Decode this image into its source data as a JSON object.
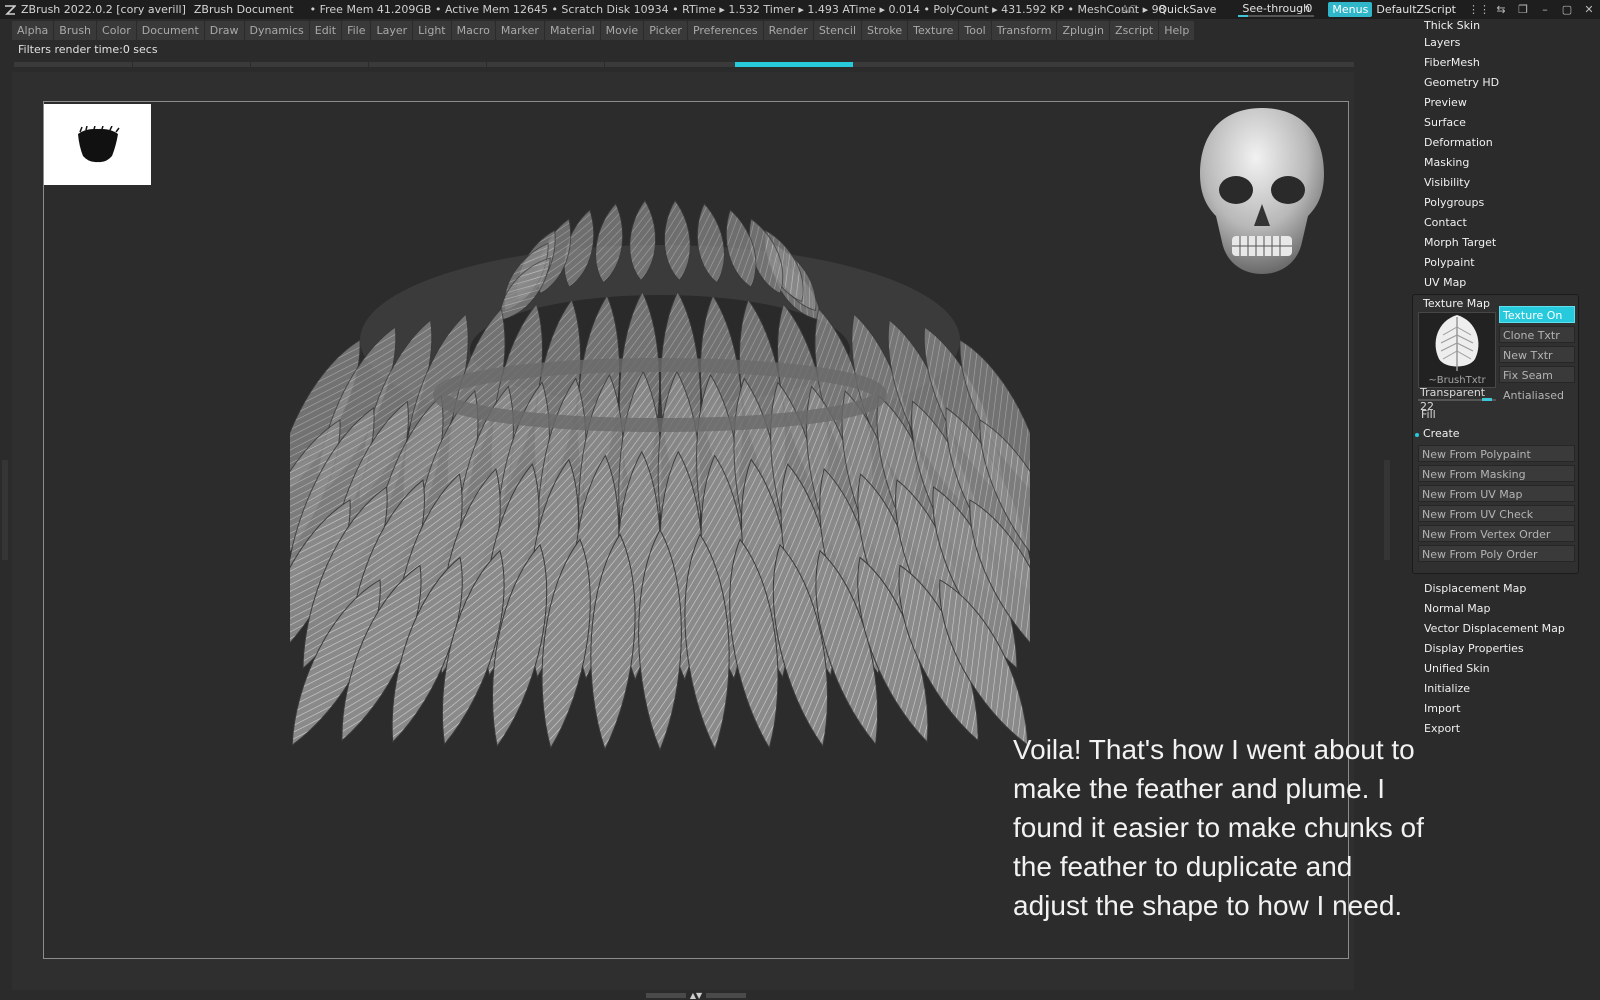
{
  "titlebar": {
    "app_title": "ZBrush 2022.0.2 [cory averill]",
    "document": "ZBrush Document",
    "stats": "• Free Mem 41.209GB • Active Mem 12645 • Scratch Disk 10934 • RTime ▸ 1.532 Timer ▸ 1.493 ATime ▸ 0.014 • PolyCount ▸ 431.592 KP • MeshCount ▸ 98",
    "ac": "AC",
    "quicksave": "QuickSave",
    "seethrough_label": "See-through",
    "seethrough_value": "0",
    "menus": "Menus",
    "default_zscript": "DefaultZScript",
    "accent": "#2fb6c8"
  },
  "menubar": [
    "Alpha",
    "Brush",
    "Color",
    "Document",
    "Draw",
    "Dynamics",
    "Edit",
    "File",
    "Layer",
    "Light",
    "Macro",
    "Marker",
    "Material",
    "Movie",
    "Picker",
    "Preferences",
    "Render",
    "Stencil",
    "Stroke",
    "Texture",
    "Tool",
    "Transform",
    "Zplugin",
    "Zscript",
    "Help"
  ],
  "status": {
    "filters": "Filters render time:0 secs"
  },
  "caption": "Voila! That's how I went about to make the feather and plume. I found it easier to make chunks of the feather to duplicate and adjust the shape to how I need.",
  "tool_palette": {
    "items_top": [
      "Thick Skin",
      "Layers",
      "FiberMesh",
      "Geometry HD",
      "Preview",
      "Surface",
      "Deformation",
      "Masking",
      "Visibility",
      "Polygroups",
      "Contact",
      "Morph Target",
      "Polypaint",
      "UV Map"
    ],
    "texture_map": {
      "title": "Texture Map",
      "thumb_label": "~BrushTxtr",
      "texture_on": "Texture On",
      "clone_txtr": "Clone Txtr",
      "new_txtr": "New Txtr",
      "fix_seam": "Fix Seam",
      "transparent_label": "Transparent",
      "transparent_value": "22",
      "antialiased": "Antialiased",
      "fill": "Fill",
      "create": "Create",
      "create_buttons": [
        "New From Polypaint",
        "New From Masking",
        "New From UV Map",
        "New From UV Check",
        "New From Vertex Order",
        "New From Poly Order"
      ]
    },
    "items_bottom": [
      "Displacement Map",
      "Normal Map",
      "Vector Displacement Map",
      "Display Properties",
      "Unified Skin",
      "Initialize",
      "Import",
      "Export"
    ]
  }
}
